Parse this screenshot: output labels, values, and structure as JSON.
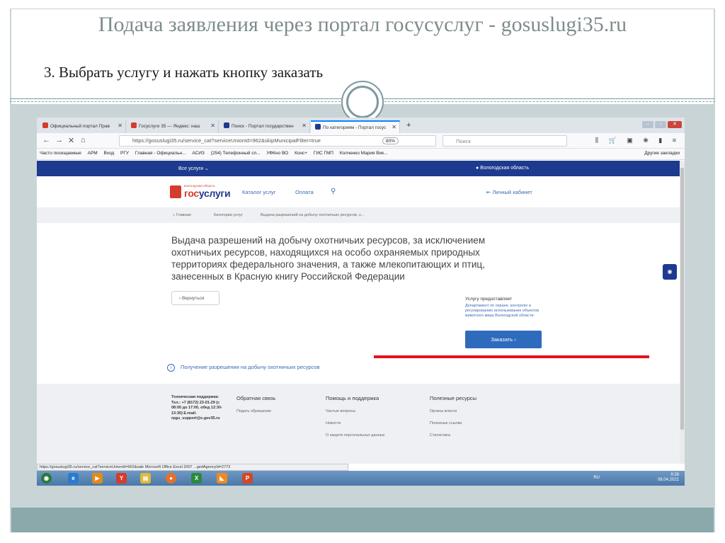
{
  "slide": {
    "title": "Подача заявления через портал госусуслуг - gosuslugi35.ru",
    "subtitle": "3. Выбрать услугу и нажать кнопку заказать"
  },
  "browser": {
    "tabs": [
      {
        "label": "Официальный портал Прав",
        "fav_color": "#d63b2b",
        "active": false
      },
      {
        "label": "Госуслуги 35 — Яндекс: наш",
        "fav_color": "#d63b2b",
        "active": false
      },
      {
        "label": "Поиск - Портал государствен",
        "fav_color": "#1d3a8e",
        "active": false
      },
      {
        "label": "По категориям - Портал госус",
        "fav_color": "#1d3a8e",
        "active": true
      }
    ],
    "new_tab": "+",
    "close_glyph": "✕",
    "url": "https://gosuslugi35.ru/service_cat?serviceUnionId=962&skipMunicipalFilter=true",
    "zoom": "80%",
    "search_placeholder": "Поиск",
    "nav_icons": "⫼ 🛒 ▣ ❀ ▮ ≡",
    "back": "←",
    "forward": "→",
    "stop": "✕",
    "home": "⌂",
    "bookmarks": [
      "Часто посещаемые",
      "АРМ",
      "Вход",
      "РГУ",
      "Главная - Официальн...",
      "АСИЗ",
      "(254) Телефонный сп...",
      "УФКно ВО",
      "Конс+",
      "ГИС ГМП",
      "Колченко Мария Вик..."
    ],
    "other_bookmarks": "Другие закладки"
  },
  "portal": {
    "all_services": "Все услуги ⌄",
    "region": "● Вологодская область",
    "logo_small": "вологодская область",
    "logo_big_1": "гос",
    "logo_big_2": "услуги",
    "nav": [
      "Каталог услуг",
      "Оплата"
    ],
    "search_icon": "⚲",
    "cabinet": "⇤  Личный кабинет",
    "breadcrumbs": [
      "⌂ Главная",
      "Категории услуг",
      "Выдача разрешений на добычу охотничьих ресурсов, з..."
    ],
    "service_title": "Выдача разрешений на добычу охотничьих ресурсов, за исключением охотничьих ресурсов, находящихся на особо охраняемых природных территориях федерального значения, а также млекопитающих и птиц, занесенных в Красную книгу Российской Федерации",
    "back_button": "‹   Вернуться",
    "provider_label": "Услугу предоставляет",
    "provider_name": "Департамент по охране, контролю и регулированию использования объектов животного мира Вологодской области",
    "order_button": "Заказать  ›",
    "subservice": "Получение разрешения на добычу охотничьих ресурсов",
    "subservice_icon": "›",
    "eye": "◉"
  },
  "footer": {
    "support": "Техническая поддержка: Тел.: +7 (8172) 23-01-29 (с 08:00 до 17:00, обед 12:30-13:30) E-mail: rpgu_support@e.gov35.ru",
    "col1_title": "Обратная связь",
    "col1_items": [
      "Подать обращение"
    ],
    "col2_title": "Помощь и поддержка",
    "col2_items": [
      "Частые вопросы",
      "Новости",
      "О защите персональных данных"
    ],
    "col3_title": "Полезные ресурсы",
    "col3_items": [
      "Органы власти",
      "Полезные ссылки",
      "Статистика"
    ]
  },
  "status_url": "https://gosuslugi35.ru/service_cat?serviceUnionId=962&sale Microsoft Office Excel 2007 ...gedAgencyId=2773",
  "taskbar": {
    "icons": [
      {
        "name": "start",
        "color": "#2b7a3a",
        "glyph": "◉"
      },
      {
        "name": "ie",
        "color": "#2a7bd0",
        "glyph": "e"
      },
      {
        "name": "media",
        "color": "#e58a14",
        "glyph": "▶"
      },
      {
        "name": "yandex",
        "color": "#d63b2b",
        "glyph": "Y"
      },
      {
        "name": "explorer",
        "color": "#e0b83a",
        "glyph": "▤"
      },
      {
        "name": "firefox",
        "color": "#e8702a",
        "glyph": "●"
      },
      {
        "name": "excel",
        "color": "#2b8a3e",
        "glyph": "X"
      },
      {
        "name": "app",
        "color": "#f08a1e",
        "glyph": "◣"
      },
      {
        "name": "powerpoint",
        "color": "#d24726",
        "glyph": "P"
      }
    ],
    "lang": "RU",
    "time": "9:28",
    "date": "08.04.2021"
  }
}
